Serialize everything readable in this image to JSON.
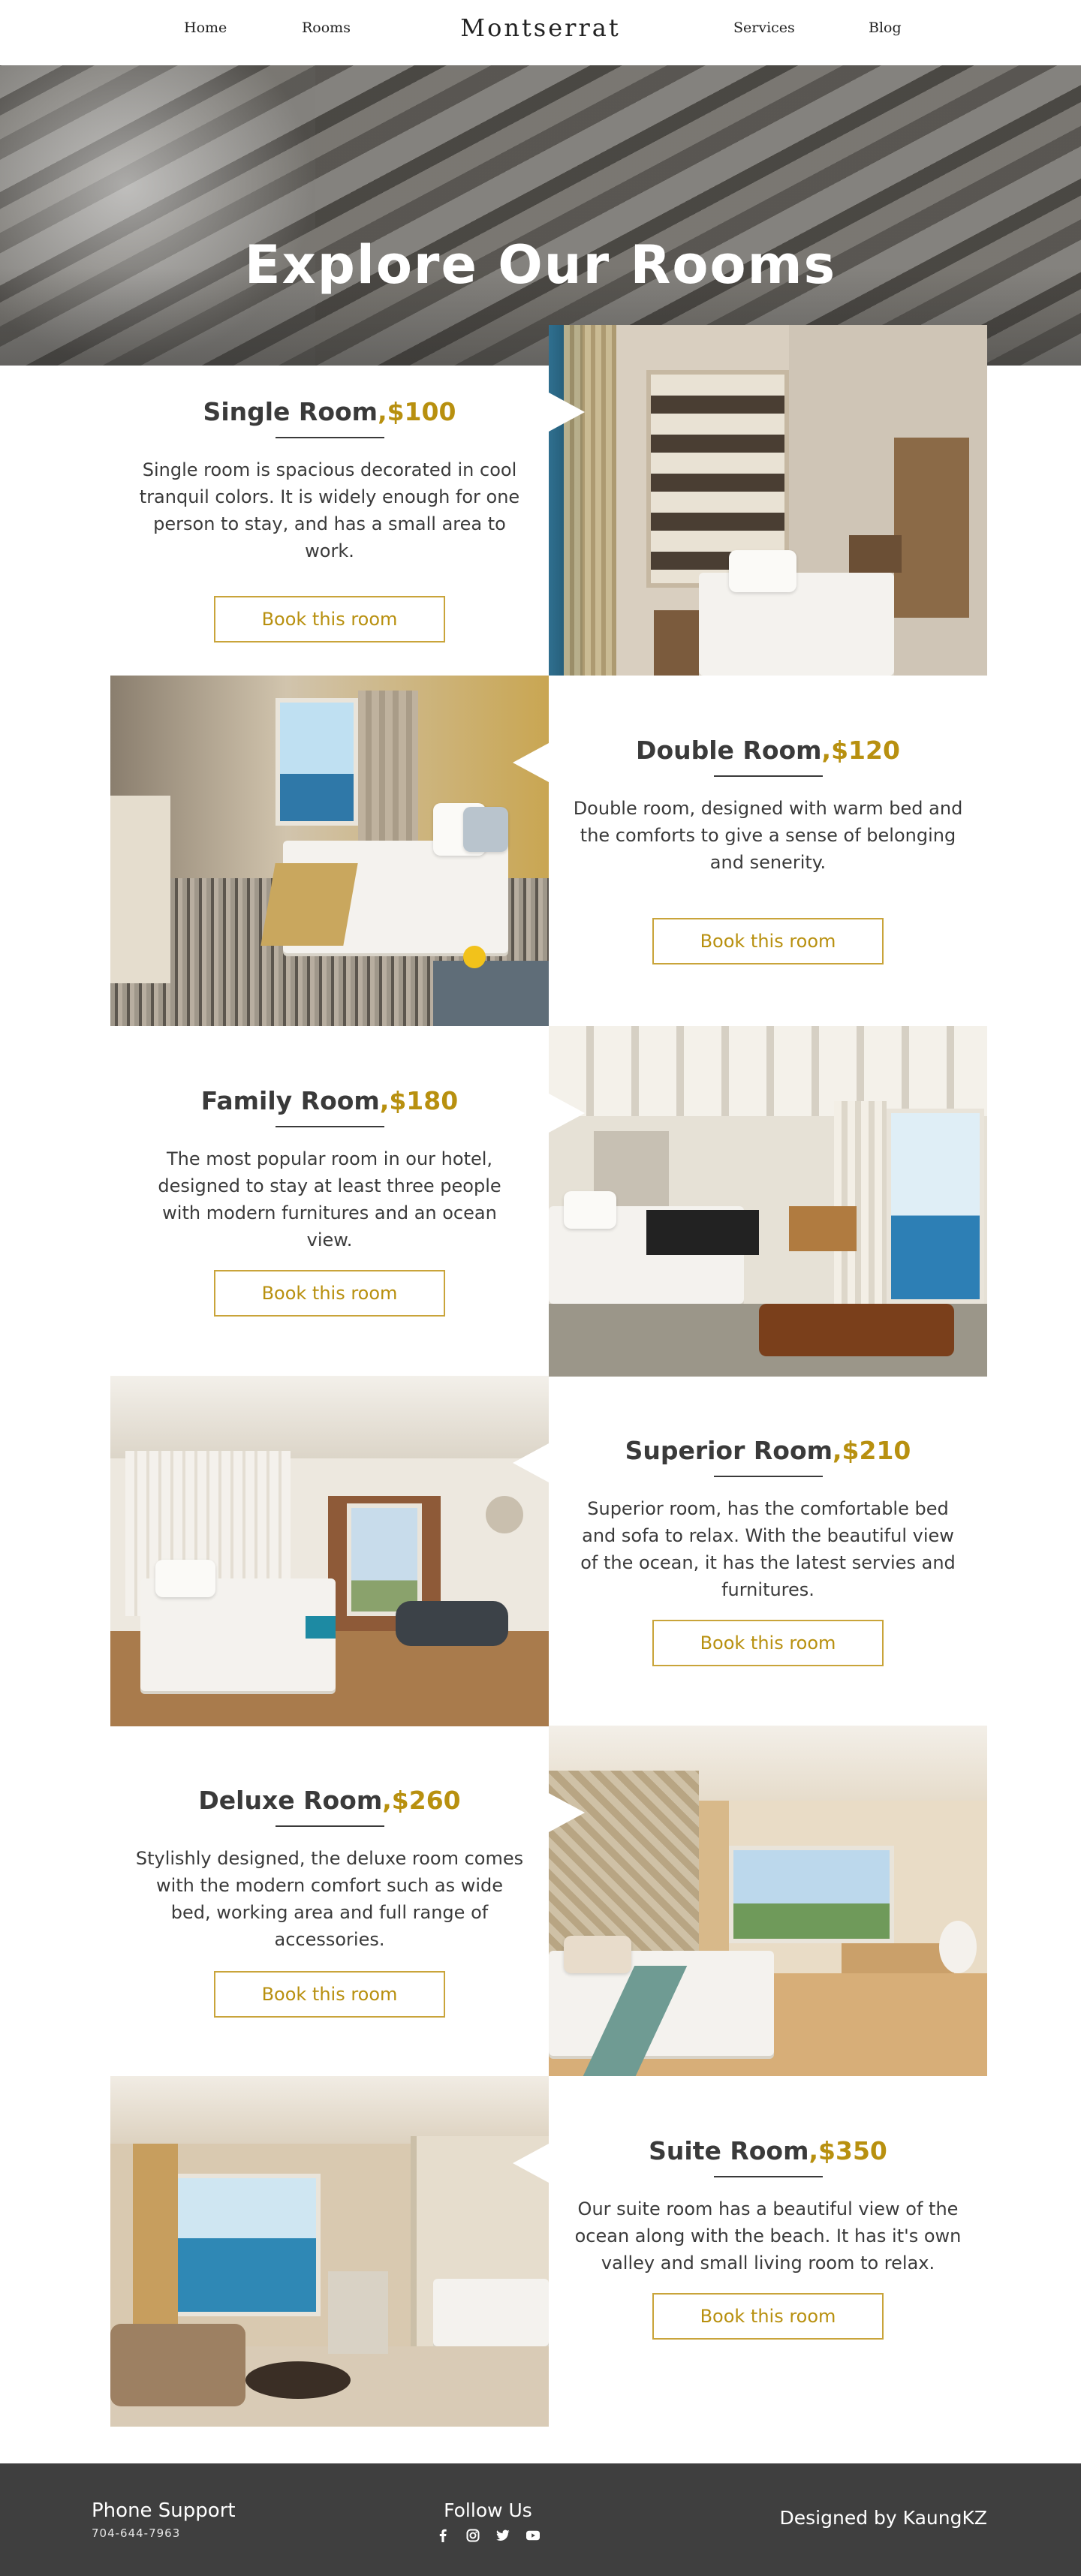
{
  "nav": {
    "items": [
      {
        "label": "Home"
      },
      {
        "label": "Rooms"
      },
      {
        "label": "Services"
      },
      {
        "label": "Blog"
      }
    ],
    "logo": "Montserrat",
    "active": "Rooms",
    "accent_color": "#b8900f"
  },
  "hero": {
    "title": "Explore Our Rooms"
  },
  "rooms": [
    {
      "name": "Single Room",
      "price": ",$100",
      "description": "Single room is spacious decorated in cool tranquil colors. It is widely enough for one person to stay, and has a small area to work.",
      "button": "Book this room"
    },
    {
      "name": "Double Room",
      "price": ",$120",
      "description": "Double room, designed with warm bed and the comforts to give a sense of belonging and senerity.",
      "button": "Book this room"
    },
    {
      "name": "Family Room",
      "price": ",$180",
      "description": "The most popular room in our hotel, designed to stay at least three people with modern furnitures and an ocean view.",
      "button": "Book this room"
    },
    {
      "name": "Superior Room",
      "price": ",$210",
      "description": "Superior room, has the comfortable bed and sofa to relax. With the beautiful view of the ocean, it has the latest servies and furnitures.",
      "button": "Book this room"
    },
    {
      "name": "Deluxe Room",
      "price": ",$260",
      "description": "Stylishly designed, the deluxe room comes with the modern comfort such as wide bed, working area and full range of accessories.",
      "button": "Book this room"
    },
    {
      "name": "Suite Room",
      "price": ",$350",
      "description": "Our suite room has a beautiful view of the ocean along with the beach. It has it's own valley and small living room to relax.",
      "button": "Book this room"
    }
  ],
  "footer": {
    "phone_label": "Phone Support",
    "phone_number": "704-644-7963",
    "follow_label": "Follow Us",
    "social_icons": [
      "facebook-icon",
      "instagram-icon",
      "twitter-icon",
      "youtube-icon"
    ],
    "credit": "Designed by KaungKZ",
    "background": "#3f3f3f"
  }
}
